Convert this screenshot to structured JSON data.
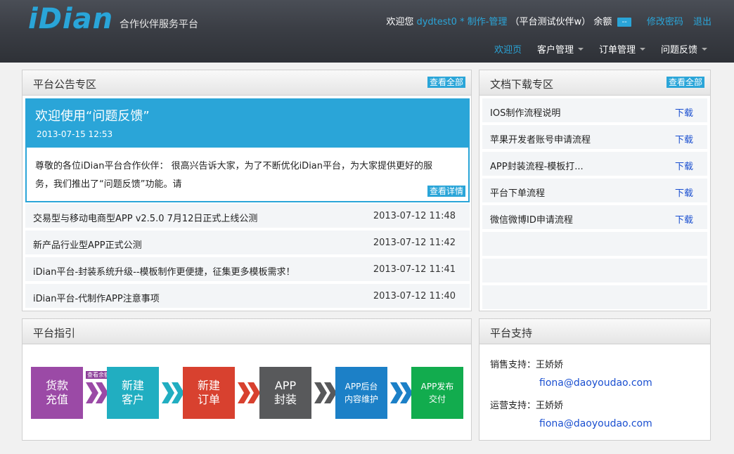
{
  "header": {
    "logo": "iDian",
    "logo_sub": "合作伙伴服务平台",
    "welcome_prefix": "欢迎您",
    "username": "dydtest0",
    "role": "* 制作-管理",
    "partner": "（平台测试伙伴w）",
    "balance_label": "余额",
    "balance_value": "--",
    "change_password": "修改密码",
    "logout": "退出"
  },
  "nav": {
    "items": [
      {
        "label": "欢迎页",
        "active": true,
        "dropdown": false
      },
      {
        "label": "客户管理",
        "active": false,
        "dropdown": true
      },
      {
        "label": "订单管理",
        "active": false,
        "dropdown": true
      },
      {
        "label": "问题反馈",
        "active": false,
        "dropdown": true
      }
    ]
  },
  "announcements": {
    "title": "平台公告专区",
    "view_all": "查看全部",
    "featured": {
      "title": "欢迎使用“问题反馈”",
      "date": "2013-07-15 12:53",
      "body": "尊敬的各位iDian平台合作伙伴： 很高兴告诉大家，为了不断优化iDian平台，为大家提供更好的服务，我们推出了“问题反馈”功能。请",
      "detail": "查看详情"
    },
    "items": [
      {
        "title": "交易型与移动电商型APP v2.5.0 7月12日正式上线公测",
        "date": "2013-07-12 11:48"
      },
      {
        "title": "新产品行业型APP正式公测",
        "date": "2013-07-12 11:42"
      },
      {
        "title": "iDian平台-封装系统升级--模板制作更便捷，征集更多模板需求！",
        "date": "2013-07-12 11:41"
      },
      {
        "title": "iDian平台-代制作APP注意事项",
        "date": "2013-07-12 11:40"
      }
    ]
  },
  "docs": {
    "title": "文档下载专区",
    "view_all": "查看全部",
    "download_label": "下载",
    "items": [
      {
        "title": "IOS制作流程说明"
      },
      {
        "title": "苹果开发者账号申请流程"
      },
      {
        "title": "APP封装流程-模板打..."
      },
      {
        "title": "平台下单流程"
      },
      {
        "title": "微信微博ID申请流程"
      }
    ]
  },
  "guide": {
    "title": "平台指引",
    "tag": "查看余额",
    "steps": [
      {
        "line1": "货款",
        "line2": "充值",
        "color": "#9b4aa6"
      },
      {
        "line1": "新建",
        "line2": "客户",
        "color": "#21aec1"
      },
      {
        "line1": "新建",
        "line2": "订单",
        "color": "#d8412f"
      },
      {
        "line1": "APP",
        "line2": "封装",
        "color": "#58595b"
      },
      {
        "line1": "APP后台",
        "line2": "内容维护",
        "color": "#1c80c7"
      },
      {
        "line1": "APP发布",
        "line2": "交付",
        "color": "#12ac4e"
      }
    ],
    "arrow_colors": [
      "#9b4aa6",
      "#21aec1",
      "#d8412f",
      "#58595b",
      "#1c80c7"
    ]
  },
  "support": {
    "title": "平台支持",
    "sales_label": "销售支持：王娇娇",
    "sales_email": "fiona@daoyoudao.com",
    "ops_label": "运营支持：王娇娇",
    "ops_email": "fiona@daoyoudao.com"
  }
}
